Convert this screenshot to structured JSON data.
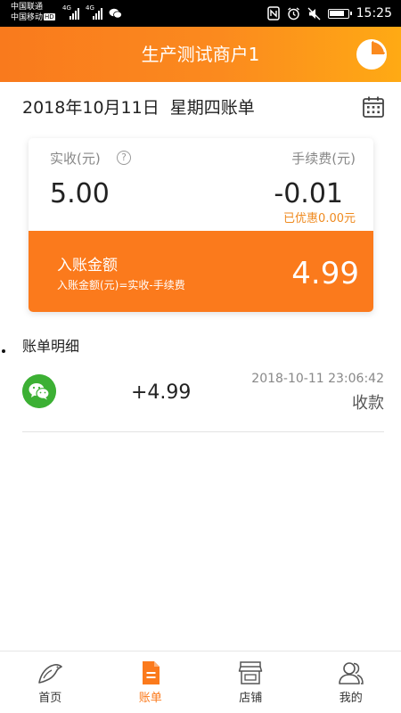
{
  "status_bar": {
    "carrier1": "中国联通",
    "carrier2": "中国移动",
    "hd": "HD",
    "net1": "4G",
    "net2": "4G",
    "time": "15:25"
  },
  "header": {
    "title": "生产测试商户1",
    "stats_icon": "pie-chart-icon"
  },
  "date_row": {
    "date": "2018年10月11日",
    "weekday_title": "星期四账单",
    "calendar_icon": "calendar-icon"
  },
  "summary": {
    "received_label": "实收(元)",
    "help_symbol": "?",
    "received_value": "5.00",
    "fee_label": "手续费(元)",
    "fee_value": "-0.01",
    "discount_text": "已优惠0.00元",
    "credited_label": "入账金额",
    "credited_formula": "入账金额(元)=实收-手续费",
    "credited_value": "4.99"
  },
  "details": {
    "title": "账单明细",
    "records": [
      {
        "icon": "wechat-pay-icon",
        "amount": "+4.99",
        "time": "2018-10-11 23:06:42",
        "status": "收款"
      }
    ]
  },
  "bottom_nav": {
    "items": [
      {
        "label": "首页",
        "icon": "home-fish-icon",
        "active": false
      },
      {
        "label": "账单",
        "icon": "bill-icon",
        "active": true
      },
      {
        "label": "店铺",
        "icon": "store-icon",
        "active": false
      },
      {
        "label": "我的",
        "icon": "users-icon",
        "active": false
      }
    ]
  },
  "colors": {
    "accent": "#fb7a1c",
    "header_gradient_start": "#f97a1d",
    "header_gradient_end": "#ffaa14",
    "discount_text": "#ef8a1f",
    "wechat_green": "#3cb034"
  }
}
